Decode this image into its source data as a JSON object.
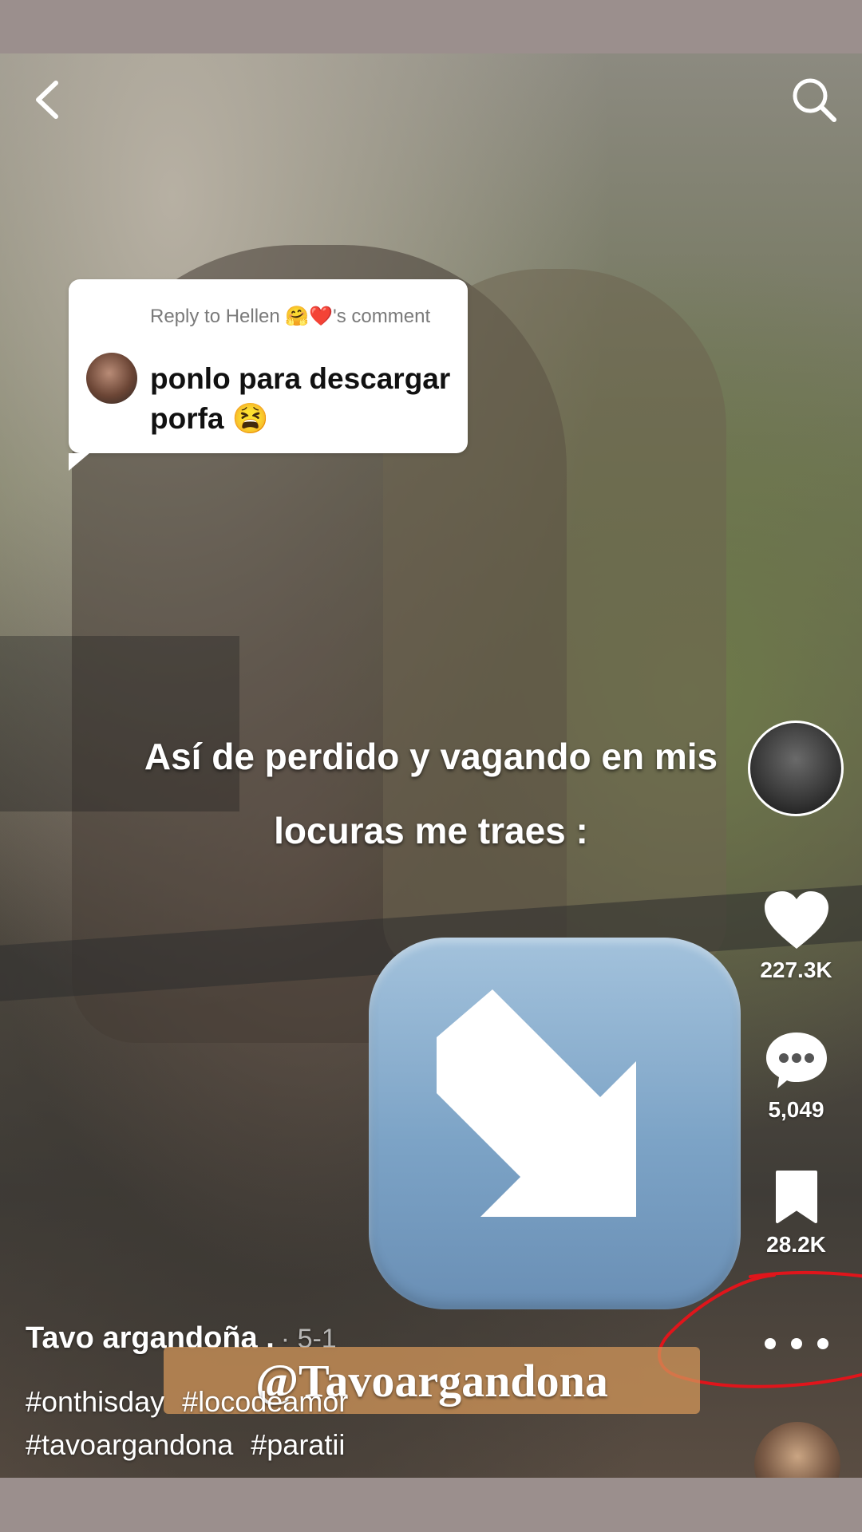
{
  "reply": {
    "header": "Reply to Hellen 🤗❤️'s comment",
    "text": "ponlo para descargar porfa 😫"
  },
  "caption": {
    "line1": "Así de perdido y vagando en mis",
    "line2": "locuras me traes :"
  },
  "actions": {
    "likes": "227.3K",
    "comments": "5,049",
    "saves": "28.2K"
  },
  "author": {
    "name": "Tavo argandoña .",
    "meta": "· 5-1"
  },
  "watermark": "@Tavoargandona",
  "hashtags": [
    "#onthisday",
    "#locodeamor",
    "#tavoargandona",
    "#paratii"
  ],
  "icons": {
    "back": "chevron-left-icon",
    "search": "search-icon",
    "like": "heart-icon",
    "comment": "comment-bubble-icon",
    "save": "bookmark-icon",
    "more": "more-dots-icon",
    "download": "down-right-arrow-emoji"
  },
  "colors": {
    "frame": "#9b8f8d",
    "badge": "#7ca3c6",
    "annotation": "#e0151b"
  }
}
